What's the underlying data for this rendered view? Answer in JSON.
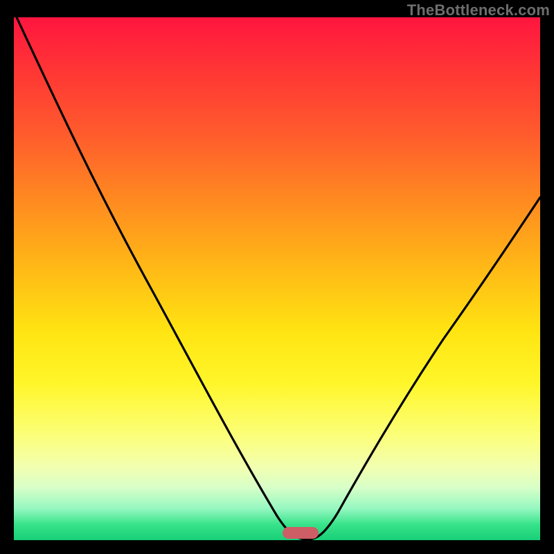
{
  "watermark": "TheBottleneck.com",
  "chart_data": {
    "type": "line",
    "title": "",
    "xlabel": "",
    "ylabel": "",
    "xlim": [
      0,
      100
    ],
    "ylim": [
      0,
      100
    ],
    "grid": false,
    "legend": false,
    "x": [
      0,
      6,
      12,
      18,
      24,
      30,
      36,
      42,
      47,
      51,
      54,
      56.5,
      58,
      61,
      66,
      72,
      80,
      90,
      100
    ],
    "values": [
      100,
      91,
      82,
      72.5,
      62,
      52,
      41,
      29,
      17,
      7,
      1.5,
      0,
      1.5,
      7,
      17,
      29,
      42,
      55,
      66
    ],
    "marker": {
      "x": 57,
      "y": 0,
      "width_x": 7,
      "color": "#cd5e66"
    },
    "background_gradient": {
      "stops": [
        {
          "pos": 0,
          "color": "#ff153f"
        },
        {
          "pos": 0.22,
          "color": "#ff5a2d"
        },
        {
          "pos": 0.48,
          "color": "#ffb916"
        },
        {
          "pos": 0.7,
          "color": "#fff62a"
        },
        {
          "pos": 0.9,
          "color": "#d7ffc8"
        },
        {
          "pos": 1.0,
          "color": "#18cf77"
        }
      ]
    }
  }
}
